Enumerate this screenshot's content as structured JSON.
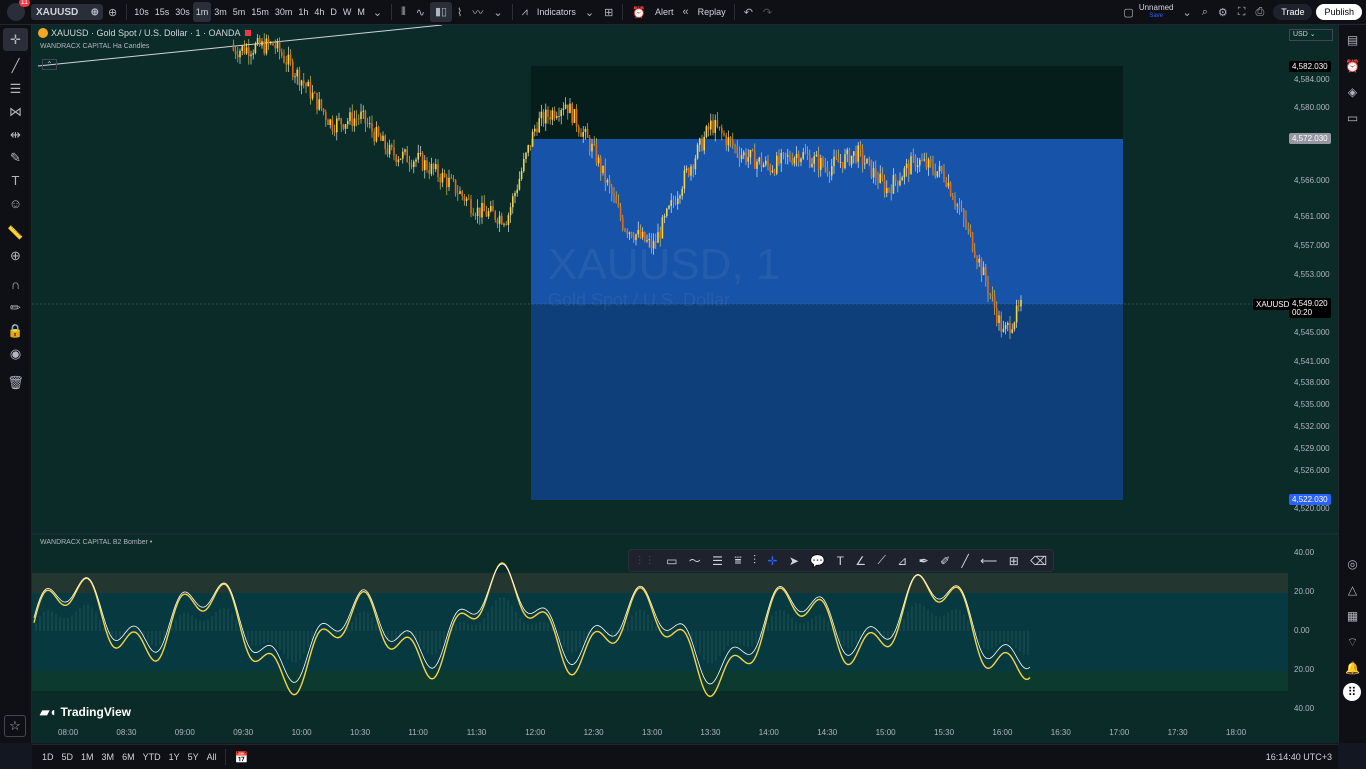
{
  "toolbar": {
    "notif_count": "11",
    "symbol": "XAUUSD",
    "intervals": [
      "10s",
      "15s",
      "30s",
      "1m",
      "3m",
      "5m",
      "15m",
      "30m",
      "1h",
      "4h",
      "D",
      "W",
      "M"
    ],
    "active_interval": "1m",
    "indicators_label": "Indicators",
    "alert_label": "Alert",
    "replay_label": "Replay",
    "layout_name": "Unnamed",
    "layout_sub": "Save",
    "trade_label": "Trade",
    "publish_label": "Publish"
  },
  "legend": {
    "title": "XAUUSD · Gold Spot / U.S. Dollar · 1 · OANDA",
    "indicator": "WANDRACX CAPITAL Ha Candles",
    "osc_indicator": "WANDRACX CAPITAL B2 Bomber •"
  },
  "watermark": {
    "line1": "XAUUSD, 1",
    "line2": "Gold Spot / U.S. Dollar"
  },
  "price_axis": {
    "currency": "USD",
    "ticks": [
      "4,584.000",
      "4,580.000",
      "4,576.000",
      "4,566.000",
      "4,561.000",
      "4,557.000",
      "4,553.000",
      "4,545.000",
      "4,541.000",
      "4,538.000",
      "4,535.000",
      "4,532.000",
      "4,529.000",
      "4,526.000",
      "4,520.000"
    ],
    "label_top": "4,582.030",
    "label_mid": "4,572.030",
    "label_current": "4,549.020",
    "label_countdown": "00:20",
    "label_symbol": "XAUUSD",
    "label_bottom": "4,522.030"
  },
  "osc_axis": {
    "ticks": [
      "40.00",
      "20.00",
      "0.00",
      "20.00",
      "40.00"
    ]
  },
  "time_axis": {
    "ticks": [
      "08:00",
      "08:30",
      "09:00",
      "09:30",
      "10:00",
      "10:30",
      "11:00",
      "11:30",
      "12:00",
      "12:30",
      "13:00",
      "13:30",
      "14:00",
      "14:30",
      "15:00",
      "15:30",
      "16:00",
      "16:30",
      "17:00",
      "17:30",
      "18:00"
    ]
  },
  "branding": "TradingView",
  "bottom": {
    "ranges": [
      "1D",
      "5D",
      "1M",
      "3M",
      "6M",
      "YTD",
      "1Y",
      "5Y",
      "All"
    ],
    "clock": "16:14:40 UTC+3"
  },
  "colors": {
    "bg": "#0a2b27",
    "up": "#f5d442",
    "down": "#e06a1b",
    "blue_zone": "#1753a8",
    "dark_zone": "#061e1b"
  },
  "chart_data": {
    "type": "candlestick",
    "title": "XAUUSD · Gold Spot / U.S. Dollar · 1 · OANDA",
    "x_ticks": [
      "08:00",
      "08:30",
      "09:00",
      "09:30",
      "10:00",
      "10:30",
      "11:00",
      "11:30",
      "12:00",
      "12:30",
      "13:00",
      "13:30",
      "14:00",
      "14:30",
      "15:00",
      "15:30",
      "16:00"
    ],
    "close_path": [
      [
        "08:00",
        null
      ],
      [
        "08:30",
        null
      ],
      [
        "09:00",
        null
      ],
      [
        "09:45",
        4585
      ],
      [
        "10:00",
        4580
      ],
      [
        "10:15",
        4574
      ],
      [
        "10:30",
        4575
      ],
      [
        "10:45",
        4570
      ],
      [
        "11:00",
        4569
      ],
      [
        "11:15",
        4566
      ],
      [
        "11:30",
        4562
      ],
      [
        "11:45",
        4561
      ],
      [
        "12:00",
        4574
      ],
      [
        "12:15",
        4577
      ],
      [
        "12:30",
        4570
      ],
      [
        "12:45",
        4560
      ],
      [
        "13:00",
        4557
      ],
      [
        "13:15",
        4566
      ],
      [
        "13:30",
        4574
      ],
      [
        "13:45",
        4570
      ],
      [
        "14:00",
        4568
      ],
      [
        "14:15",
        4570
      ],
      [
        "14:30",
        4568
      ],
      [
        "14:45",
        4570
      ],
      [
        "15:00",
        4565
      ],
      [
        "15:15",
        4569
      ],
      [
        "15:30",
        4567
      ],
      [
        "15:45",
        4557
      ],
      [
        "16:00",
        4545
      ],
      [
        "16:10",
        4549
      ]
    ],
    "ylim": [
      4519,
      4586
    ]
  }
}
